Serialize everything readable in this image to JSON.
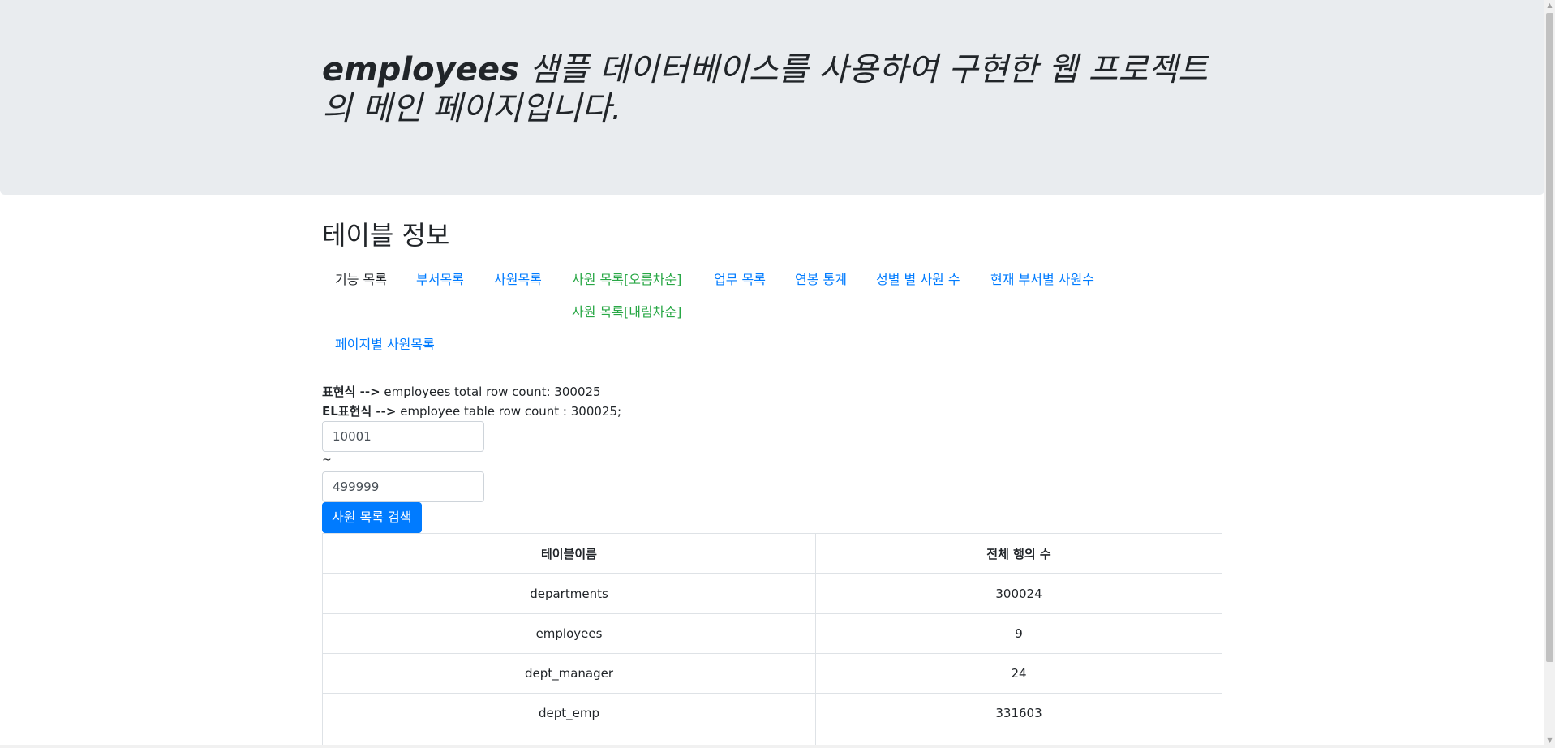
{
  "header": {
    "title_strong": "employees",
    "title_rest": " 샘플 데이터베이스를 사용하여 구현한 웹 프로젝트의 메인 페이지입니다."
  },
  "section": {
    "title": "테이블 정보"
  },
  "nav": {
    "label": "기능 목록",
    "items": [
      {
        "label": "부서목록",
        "color": "#007bff"
      },
      {
        "label": "사원목록",
        "color": "#007bff"
      },
      {
        "label": "사원 목록[오름차순]",
        "color": "#28a745"
      },
      {
        "label": "사원 목록[내림차순]",
        "color": "#28a745"
      },
      {
        "label": "업무 목록",
        "color": "#007bff"
      },
      {
        "label": "연봉 통계",
        "color": "#007bff"
      },
      {
        "label": "성별 별 사원 수",
        "color": "#007bff"
      },
      {
        "label": "현재 부서별 사원수",
        "color": "#007bff"
      },
      {
        "label": "페이지별 사원목록",
        "color": "#007bff"
      }
    ]
  },
  "expressions": {
    "line1_label": "표현식 -->",
    "line1_text": " employees total row count: 300025",
    "line2_label": "EL표현식 -->",
    "line2_text": " employee table row count : 300025;"
  },
  "search": {
    "begin_value": "10001",
    "separator": "~",
    "end_value": "499999",
    "button_label": "사원 목록 검색"
  },
  "table": {
    "headers": [
      "테이블이름",
      "전체 행의 수"
    ],
    "rows": [
      [
        "departments",
        "300024"
      ],
      [
        "employees",
        "9"
      ],
      [
        "dept_manager",
        "24"
      ],
      [
        "dept_emp",
        "331603"
      ],
      [
        "",
        ""
      ]
    ]
  },
  "colors": {
    "jumbotron_bg": "#e9ecef",
    "link_blue": "#007bff",
    "link_green": "#28a745",
    "button_primary": "#007bff"
  },
  "icons": {
    "scroll_up": "scroll-up-arrow-icon",
    "scroll_down": "scroll-down-arrow-icon"
  }
}
